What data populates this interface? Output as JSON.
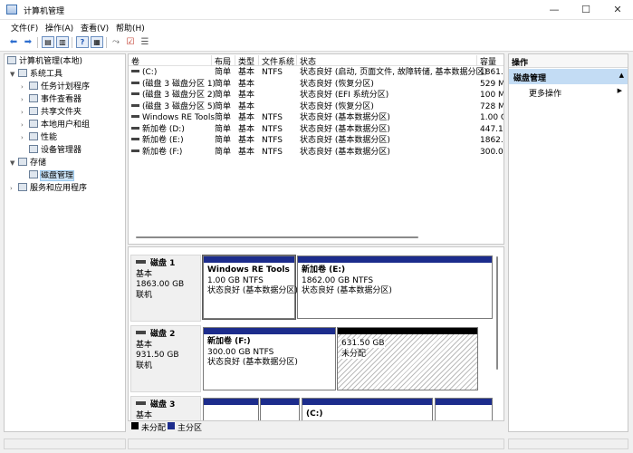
{
  "window": {
    "title": "计算机管理",
    "minimize": "—",
    "maximize": "☐",
    "close": "✕"
  },
  "menu": [
    "文件(F)",
    "操作(A)",
    "查看(V)",
    "帮助(H)"
  ],
  "toolbar": {
    "icons": [
      "back-arrow-icon",
      "forward-arrow-icon",
      "up-folder-icon",
      "properties-icon",
      "help-icon",
      "show-hide-tree-icon",
      "connect-icon",
      "check-icon",
      "list-icon"
    ]
  },
  "tree": {
    "root": "计算机管理(本地)",
    "items": [
      {
        "label": "系统工具",
        "level": 1,
        "expand": "▼",
        "icon": "tools-icon"
      },
      {
        "label": "任务计划程序",
        "level": 2,
        "expand": "›",
        "icon": "clock-icon"
      },
      {
        "label": "事件查看器",
        "level": 2,
        "expand": "›",
        "icon": "event-viewer-icon"
      },
      {
        "label": "共享文件夹",
        "level": 2,
        "expand": "›",
        "icon": "shared-folder-icon"
      },
      {
        "label": "本地用户和组",
        "level": 2,
        "expand": "›",
        "icon": "users-icon"
      },
      {
        "label": "性能",
        "level": 2,
        "expand": "›",
        "icon": "performance-icon"
      },
      {
        "label": "设备管理器",
        "level": 2,
        "expand": "",
        "icon": "device-manager-icon"
      },
      {
        "label": "存储",
        "level": 1,
        "expand": "▼",
        "icon": "storage-icon"
      },
      {
        "label": "磁盘管理",
        "level": 2,
        "expand": "",
        "icon": "disk-management-icon",
        "selected": true
      },
      {
        "label": "服务和应用程序",
        "level": 1,
        "expand": "›",
        "icon": "services-icon"
      }
    ]
  },
  "volumes": {
    "columns": [
      "卷",
      "布局",
      "类型",
      "文件系统",
      "状态",
      "容量"
    ],
    "rows": [
      [
        "(C:)",
        "简单",
        "基本",
        "NTFS",
        "状态良好 (启动, 页面文件, 故障转储, 基本数据分区)",
        "1861.6"
      ],
      [
        "(磁盘 3 磁盘分区 1)",
        "简单",
        "基本",
        "",
        "状态良好 (恢复分区)",
        "529 MI"
      ],
      [
        "(磁盘 3 磁盘分区 2)",
        "简单",
        "基本",
        "",
        "状态良好 (EFI 系统分区)",
        "100 MI"
      ],
      [
        "(磁盘 3 磁盘分区 5)",
        "简单",
        "基本",
        "",
        "状态良好 (恢复分区)",
        "728 MI"
      ],
      [
        "Windows RE Tools",
        "简单",
        "基本",
        "NTFS",
        "状态良好 (基本数据分区)",
        "1.00 GI"
      ],
      [
        "新加卷 (D:)",
        "简单",
        "基本",
        "NTFS",
        "状态良好 (基本数据分区)",
        "447.11"
      ],
      [
        "新加卷 (E:)",
        "简单",
        "基本",
        "NTFS",
        "状态良好 (基本数据分区)",
        "1862.0"
      ],
      [
        "新加卷 (F:)",
        "简单",
        "基本",
        "NTFS",
        "状态良好 (基本数据分区)",
        "300.00"
      ]
    ]
  },
  "disks": [
    {
      "name": "磁盘 1",
      "type": "基本",
      "size": "1863.00 GB",
      "status": "联机",
      "partitions": [
        {
          "name": "Windows RE Tools",
          "size": "1.00 GB NTFS",
          "status": "状态良好 (基本数据分区)"
        },
        {
          "name": "新加卷  (E:)",
          "size": "1862.00 GB NTFS",
          "status": "状态良好 (基本数据分区)"
        }
      ]
    },
    {
      "name": "磁盘 2",
      "type": "基本",
      "size": "931.50 GB",
      "status": "联机",
      "partitions": [
        {
          "name": "新加卷  (F:)",
          "size": "300.00 GB NTFS",
          "status": "状态良好 (基本数据分区)"
        },
        {
          "name": "",
          "size": "631.50 GB",
          "status": "未分配"
        }
      ]
    },
    {
      "name": "磁盘 3",
      "type": "基本",
      "size": "",
      "status": "",
      "partitions": [
        {
          "name": "",
          "size": "",
          "status": ""
        },
        {
          "name": "",
          "size": "",
          "status": ""
        },
        {
          "name": "(C:)",
          "size": "",
          "status": ""
        },
        {
          "name": "",
          "size": "",
          "status": ""
        }
      ]
    }
  ],
  "legend": [
    {
      "label": "未分配",
      "color": "#000000"
    },
    {
      "label": "主分区",
      "color": "#1c2c8c"
    }
  ],
  "actions": {
    "header": "操作",
    "section": "磁盘管理",
    "section_arrow": "▲",
    "item": "更多操作",
    "item_arrow": "▶"
  }
}
